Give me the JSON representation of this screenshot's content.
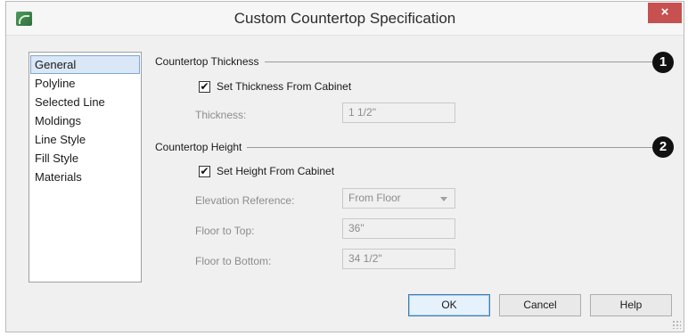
{
  "window": {
    "title": "Custom Countertop Specification",
    "close_label": "×"
  },
  "nav": {
    "items": [
      {
        "label": "General",
        "selected": true
      },
      {
        "label": "Polyline",
        "selected": false
      },
      {
        "label": "Selected Line",
        "selected": false
      },
      {
        "label": "Moldings",
        "selected": false
      },
      {
        "label": "Line Style",
        "selected": false
      },
      {
        "label": "Fill Style",
        "selected": false
      },
      {
        "label": "Materials",
        "selected": false
      }
    ]
  },
  "thickness_group": {
    "label": "Countertop Thickness",
    "callout": "1",
    "checkbox_label": "Set Thickness From Cabinet",
    "checkbox_checked": true,
    "thickness_label": "Thickness:",
    "thickness_value": "1 1/2\""
  },
  "height_group": {
    "label": "Countertop Height",
    "callout": "2",
    "checkbox_label": "Set Height From Cabinet",
    "checkbox_checked": true,
    "elevation_label": "Elevation Reference:",
    "elevation_value": "From Floor",
    "floor_top_label": "Floor to Top:",
    "floor_top_value": "36\"",
    "floor_bottom_label": "Floor to Bottom:",
    "floor_bottom_value": "34 1/2\""
  },
  "buttons": {
    "ok": "OK",
    "cancel": "Cancel",
    "help": "Help"
  },
  "check_glyph": "✔",
  "colors": {
    "close_button": "#c75050",
    "selection": "#d9e7f7",
    "disabled_text": "#8c8c8c"
  }
}
